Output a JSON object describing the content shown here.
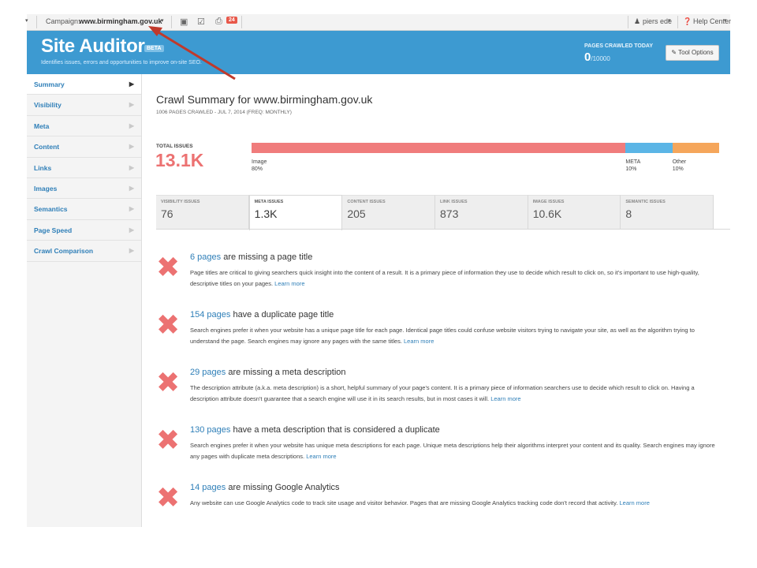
{
  "topbar": {
    "campaign_label": "Campaign:",
    "campaign_value": "www.birmingham.gov.uk",
    "notification_count": "24",
    "user_name": "piers ede",
    "help_label": "Help Center"
  },
  "header": {
    "title": "Site Auditor",
    "badge": "BETA",
    "subtitle": "Identifies issues, errors and opportunities to improve on-site SEO.",
    "crawled_label": "PAGES CRAWLED TODAY",
    "crawled_value": "0",
    "crawled_limit": "/10000",
    "tool_options_label": "Tool Options",
    "brand_color": "#3d9ad1"
  },
  "sidebar": {
    "items": [
      {
        "label": "Summary",
        "active": true
      },
      {
        "label": "Visibility"
      },
      {
        "label": "Meta"
      },
      {
        "label": "Content"
      },
      {
        "label": "Links"
      },
      {
        "label": "Images"
      },
      {
        "label": "Semantics"
      },
      {
        "label": "Page Speed"
      },
      {
        "label": "Crawl Comparison"
      }
    ]
  },
  "summary": {
    "title": "Crawl Summary for www.birmingham.gov.uk",
    "subtitle": "1006 PAGES CRAWLED - JUL 7, 2014 (FREQ: MONTHLY)",
    "total_label": "TOTAL ISSUES",
    "total_value": "13.1K"
  },
  "issue_breakdown": [
    {
      "name": "Image",
      "percent_label": "80%",
      "percent": 80,
      "color": "#f07c7c"
    },
    {
      "name": "META",
      "percent_label": "10%",
      "percent": 10,
      "color": "#5bb5e6"
    },
    {
      "name": "Other",
      "percent_label": "10%",
      "percent": 10,
      "color": "#f5a65b"
    }
  ],
  "tabs": [
    {
      "label": "VISIBILITY ISSUES",
      "value": "76"
    },
    {
      "label": "META ISSUES",
      "value": "1.3K",
      "active": true
    },
    {
      "label": "CONTENT ISSUES",
      "value": "205"
    },
    {
      "label": "LINK ISSUES",
      "value": "873"
    },
    {
      "label": "IMAGE ISSUES",
      "value": "10.6K"
    },
    {
      "label": "SEMANTIC ISSUES",
      "value": "8"
    }
  ],
  "issues": [
    {
      "count": "6 pages",
      "title": " are missing a page title",
      "desc": "Page titles are critical to giving searchers quick insight into the content of a result. It is a primary piece of information they use to decide which result to click on, so it's important to use high-quality, descriptive titles on your pages.",
      "learn_more": "Learn more"
    },
    {
      "count": "154 pages",
      "title": " have a duplicate page title",
      "desc": "Search engines prefer it when your website has a unique page title for each page. Identical page titles could confuse website visitors trying to navigate your site, as well as the algorithm trying to understand the page. Search engines may ignore any pages with the same titles.",
      "learn_more": "Learn more"
    },
    {
      "count": "29 pages",
      "title": " are missing a meta description",
      "desc": "The description attribute (a.k.a. meta description) is a short, helpful summary of your page's content. It is a primary piece of information searchers use to decide which result to click on. Having a description attribute doesn't guarantee that a search engine will use it in its search results, but in most cases it will.",
      "learn_more": "Learn more"
    },
    {
      "count": "130 pages",
      "title": " have a meta description that is considered a duplicate",
      "desc": "Search engines prefer it when your website has unique meta descriptions for each page. Unique meta descriptions help their algorithms interpret your content and its quality. Search engines may ignore any pages with duplicate meta descriptions.",
      "learn_more": "Learn more"
    },
    {
      "count": "14 pages",
      "title": " are missing Google Analytics",
      "desc": "Any website can use Google Analytics code to track site usage and visitor behavior. Pages that are missing Google Analytics tracking code don't record that activity.",
      "learn_more": "Learn more"
    }
  ],
  "annotation": {
    "color": "#c0392b"
  }
}
